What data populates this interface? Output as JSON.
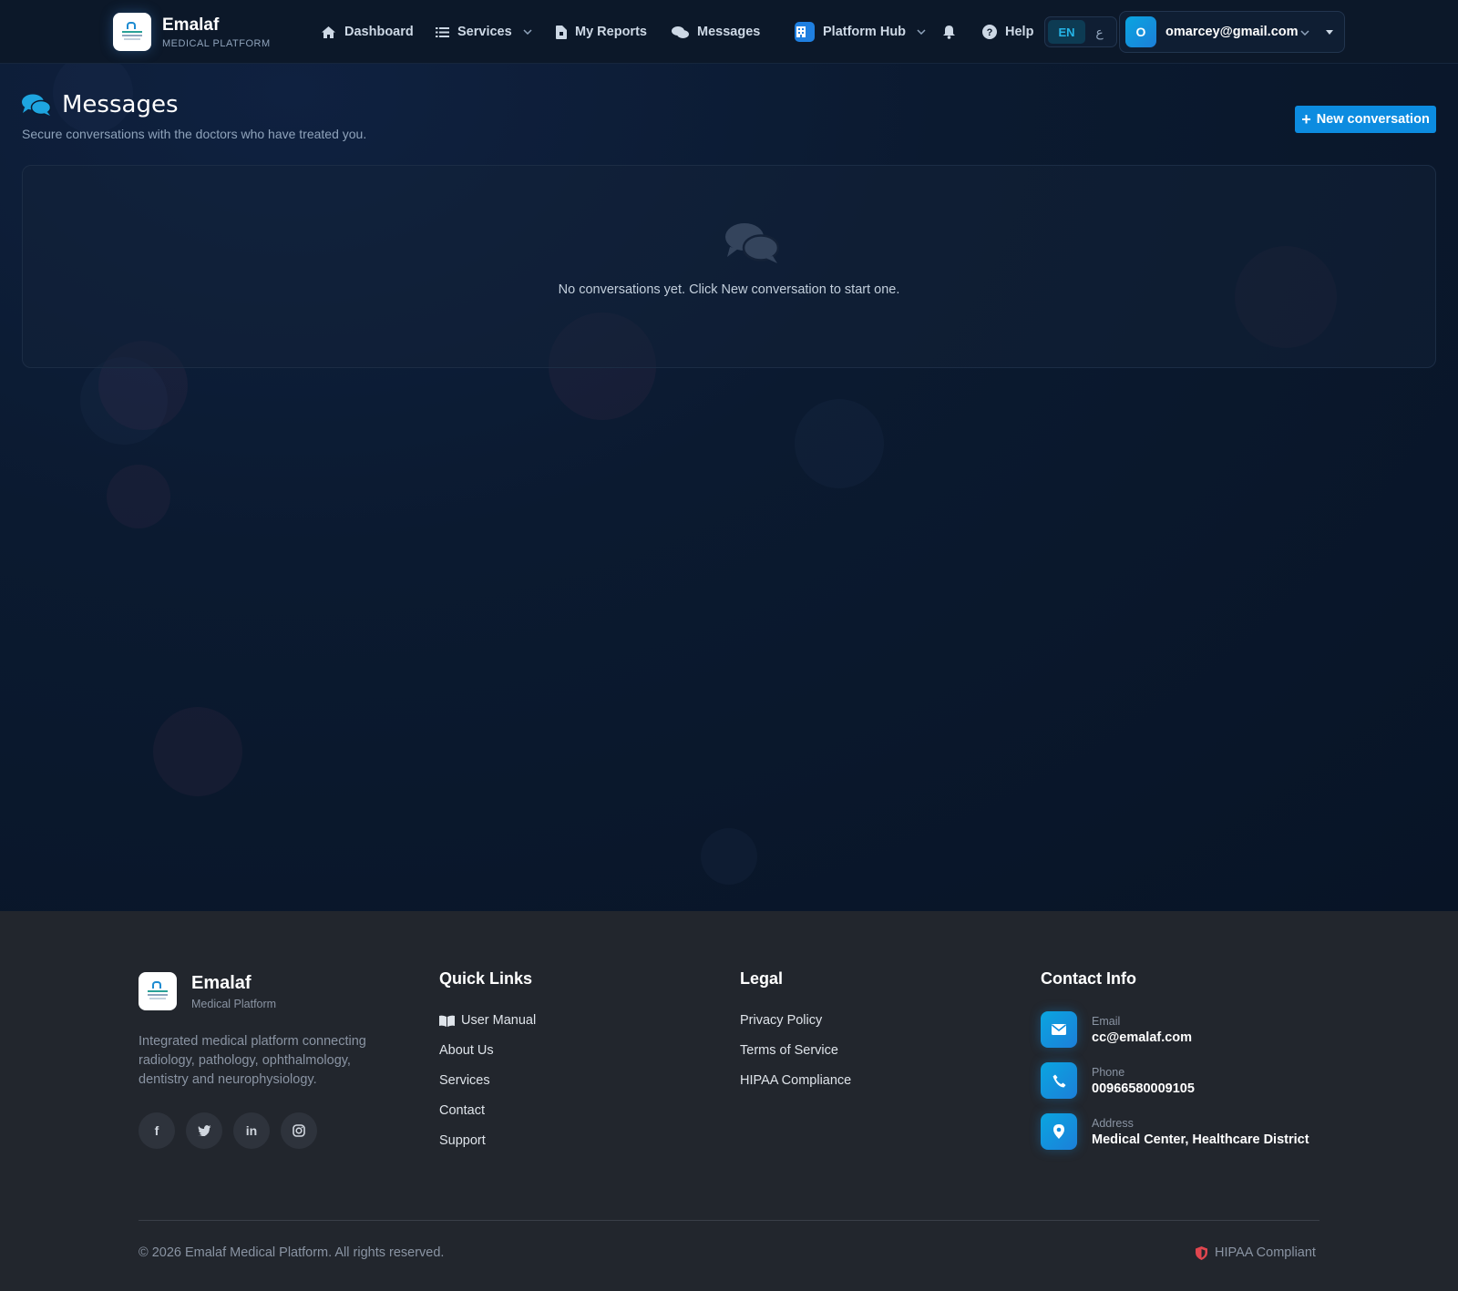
{
  "brand": {
    "name": "Emalaf",
    "subtitle": "MEDICAL PLATFORM"
  },
  "nav": {
    "dashboard": "Dashboard",
    "services": "Services",
    "reports": "My Reports",
    "messages": "Messages",
    "hub": "Platform Hub",
    "help": "Help",
    "lang_en": "EN",
    "lang_ar": "ع",
    "user_initial": "O",
    "user_email": "omarcey@gmail.com"
  },
  "page": {
    "title": "Messages",
    "subtitle": "Secure conversations with the doctors who have treated you.",
    "new_button": "New conversation",
    "empty_text": "No conversations yet. Click New conversation to start one."
  },
  "footer": {
    "brand_name": "Emalaf",
    "brand_sub": "Medical Platform",
    "description": "Integrated medical platform connecting radiology, pathology, ophthalmology, dentistry and neurophysiology.",
    "socials": [
      "f",
      "twitter",
      "in",
      "instagram"
    ],
    "quick_links_title": "Quick Links",
    "quick_links": [
      "User Manual",
      "About Us",
      "Services",
      "Contact",
      "Support"
    ],
    "legal_title": "Legal",
    "legal": [
      "Privacy Policy",
      "Terms of Service",
      "HIPAA Compliance"
    ],
    "contact_title": "Contact Info",
    "contact": [
      {
        "label": "Email",
        "value": "cc@emalaf.com",
        "icon": "envelope-icon"
      },
      {
        "label": "Phone",
        "value": "00966580009105",
        "icon": "phone-icon"
      },
      {
        "label": "Address",
        "value": "Medical Center, Healthcare District",
        "icon": "map-pin-icon"
      }
    ],
    "copyright": "© 2026 Emalaf Medical Platform. All rights reserved.",
    "hipaa": "HIPAA Compliant"
  },
  "colors": {
    "accent": "#0c8ce0",
    "nav_bg": "#0c1829",
    "footer_bg": "#22262d",
    "hipaa_red": "#e0464f"
  }
}
